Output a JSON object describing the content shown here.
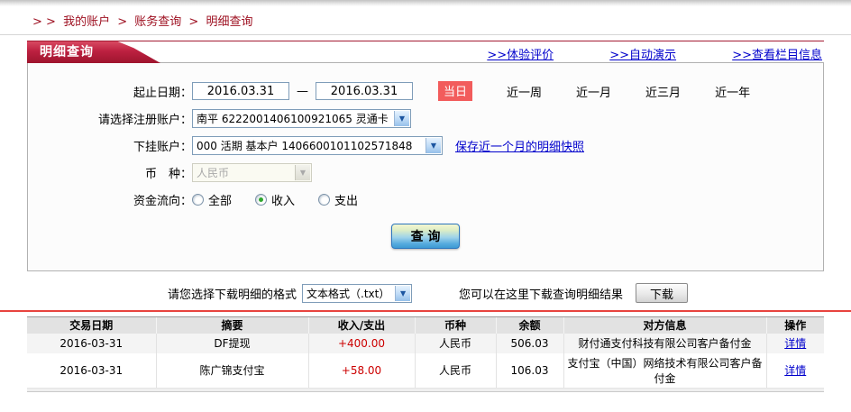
{
  "breadcrumb": {
    "prefix": "> >",
    "sep": ">",
    "items": [
      "我的账户",
      "账务查询",
      "明细查询"
    ]
  },
  "tab_title": "明细查询",
  "header_links": [
    {
      "label": ">>体验评价"
    },
    {
      "label": ">>自动演示"
    },
    {
      "label": ">>查看栏目信息"
    }
  ],
  "form": {
    "date_label": "起止日期：",
    "date_from": "2016.03.31",
    "date_to": "2016.03.31",
    "date_dash": "—",
    "quick_active": "当日",
    "quick_links": [
      {
        "label": "近一周"
      },
      {
        "label": "近一月"
      },
      {
        "label": "近三月"
      },
      {
        "label": "近一年"
      }
    ],
    "account_label": "请选择注册账户：",
    "account_value": "南平 6222001406100921065 灵通卡",
    "sub_account_label": "下挂账户：",
    "sub_account_value": "000 活期 基本户 1406600101102571848",
    "snapshot_link": "保存近一个月的明细快照",
    "currency_label": "币　种：",
    "currency_value": "人民币",
    "flow_label": "资金流向：",
    "flow_options": [
      {
        "label": "全部",
        "checked": false
      },
      {
        "label": "收入",
        "checked": true
      },
      {
        "label": "支出",
        "checked": false
      }
    ],
    "query_button": "查 询"
  },
  "download": {
    "format_label": "请您选择下载明细的格式",
    "format_value": "文本格式（.txt）",
    "result_label": "您可以在这里下载查询明细结果",
    "button": "下载"
  },
  "table": {
    "headers": [
      "交易日期",
      "摘要",
      "收入/支出",
      "币种",
      "余额",
      "对方信息",
      "操作"
    ],
    "rows": [
      {
        "date": "2016-03-31",
        "summary": "DF提现",
        "amount": "+400.00",
        "currency": "人民币",
        "balance": "506.03",
        "counterparty": "财付通支付科技有限公司客户备付金",
        "action": "详情"
      },
      {
        "date": "2016-03-31",
        "summary": "陈广锦支付宝",
        "amount": "+58.00",
        "currency": "人民币",
        "balance": "106.03",
        "counterparty": "支付宝（中国）网络技术有限公司客户备付金",
        "action": "详情"
      }
    ]
  },
  "colors": {
    "brand_red": "#b01c34",
    "badge_red": "#f25c5c",
    "amount_red": "#cc0000",
    "link_blue": "#0000cc",
    "separator_red": "#e8443f"
  }
}
